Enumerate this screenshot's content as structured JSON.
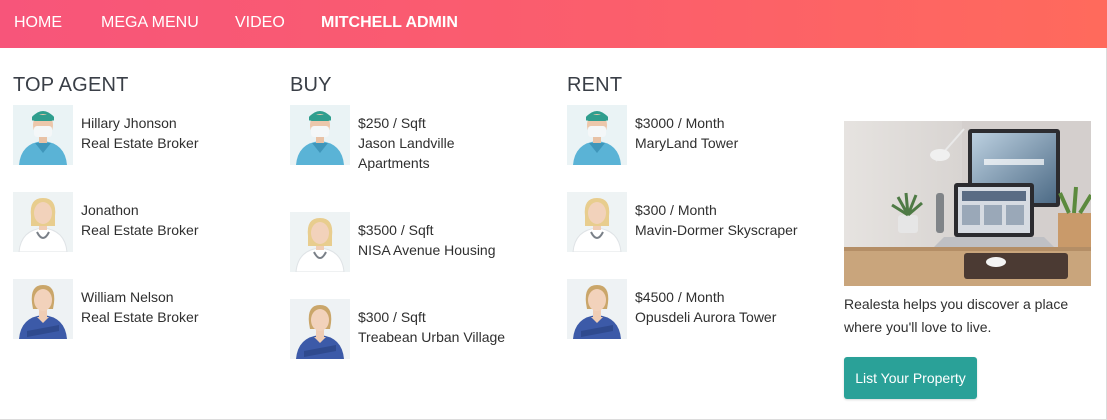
{
  "nav": {
    "items": [
      "HOME",
      "MEGA MENU",
      "VIDEO",
      "MITCHELL ADMIN"
    ]
  },
  "columns": {
    "agents": {
      "title": "TOP AGENT",
      "items": [
        {
          "line1": "Hillary Jhonson",
          "line2": "Real Estate Broker",
          "avatar": "surgeon-in-scrubs"
        },
        {
          "line1": "Jonathon",
          "line2": "Real Estate Broker",
          "avatar": "doctor-with-stethoscope"
        },
        {
          "line1": "William Nelson",
          "line2": "Real Estate Broker",
          "avatar": "nurse-in-blue-scrubs"
        }
      ]
    },
    "buy": {
      "title": "BUY",
      "items": [
        {
          "line1": "$250 / Sqft",
          "line2": "Jason Landville Apartments",
          "avatar": "surgeon-in-scrubs"
        },
        {
          "line1": "$3500 / Sqft",
          "line2": "NISA Avenue Housing",
          "avatar": "doctor-with-stethoscope"
        },
        {
          "line1": "$300 / Sqft",
          "line2": "Treabean Urban Village",
          "avatar": "nurse-in-blue-scrubs"
        }
      ]
    },
    "rent": {
      "title": "RENT",
      "items": [
        {
          "line1": "$3000 / Month",
          "line2": "MaryLand Tower",
          "avatar": "surgeon-in-scrubs"
        },
        {
          "line1": "$300 / Month",
          "line2": "Mavin-Dormer Skyscraper",
          "avatar": "doctor-with-stethoscope"
        },
        {
          "line1": "$4500 / Month",
          "line2": "Opusdeli Aurora Tower",
          "avatar": "nurse-in-blue-scrubs"
        }
      ]
    }
  },
  "promo": {
    "image": "laptop-on-desk-photo",
    "text": "Realesta helps you discover a place where you'll love to live.",
    "button_label": "List Your Property"
  },
  "colors": {
    "nav_gradient_start": "#f7557a",
    "nav_gradient_end": "#ff6a5c",
    "button": "#2aa198",
    "heading": "#3a3f47"
  }
}
